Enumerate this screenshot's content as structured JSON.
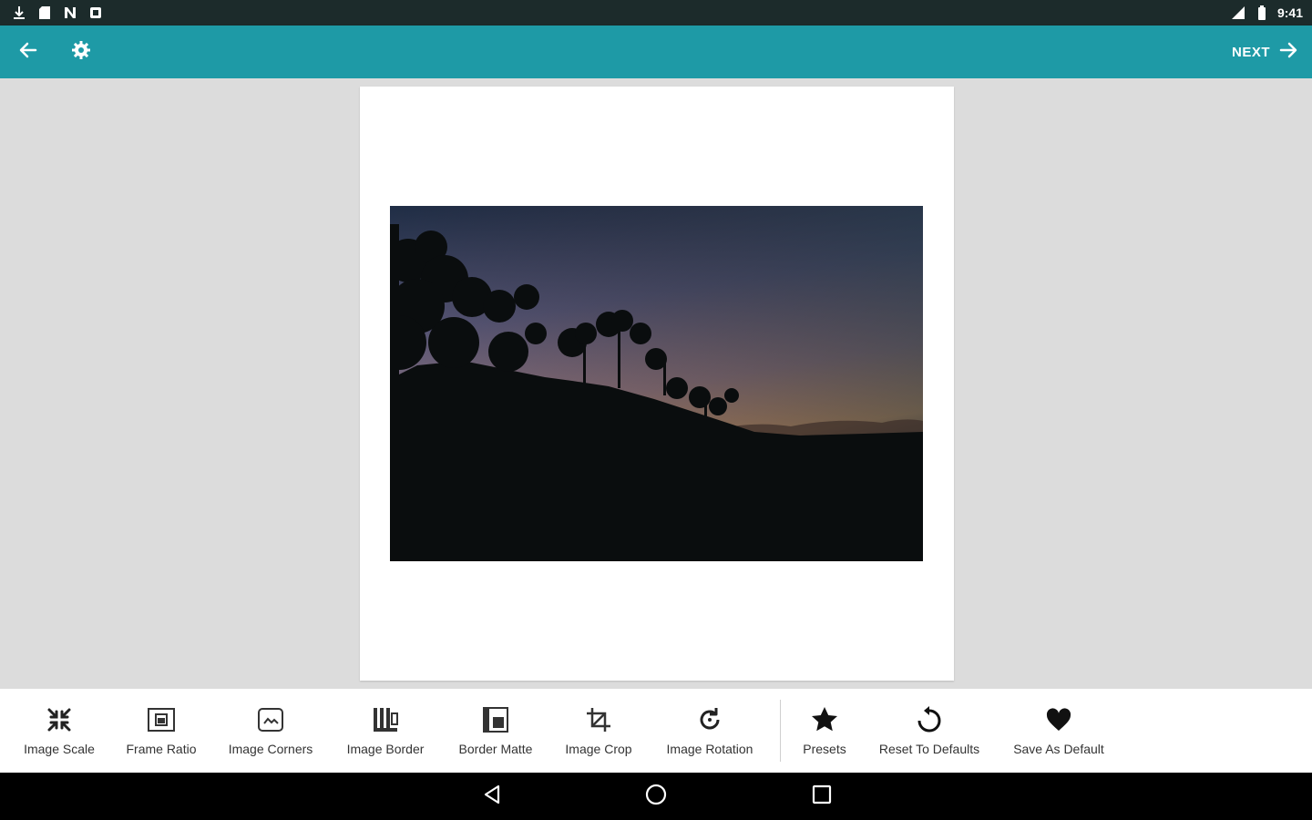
{
  "status_bar": {
    "time": "9:41",
    "left_icons": [
      "download-icon",
      "sd-card-icon",
      "n-icon",
      "notification-icon"
    ],
    "right_icons": [
      "signal-icon",
      "battery-icon"
    ]
  },
  "app_bar": {
    "back_icon": "arrow-left-icon",
    "settings_icon": "gear-icon",
    "next_label": "NEXT",
    "next_icon": "arrow-right-icon",
    "color": "#1e9aa6"
  },
  "toolbar": {
    "items": [
      {
        "label": "Image Scale",
        "icon": "scale-arrows-icon"
      },
      {
        "label": "Frame Ratio",
        "icon": "frame-ratio-icon"
      },
      {
        "label": "Image Corners",
        "icon": "image-corners-icon"
      },
      {
        "label": "Image Border",
        "icon": "image-border-icon"
      },
      {
        "label": "Border Matte",
        "icon": "border-matte-icon"
      },
      {
        "label": "Image Crop",
        "icon": "crop-icon"
      },
      {
        "label": "Image Rotation",
        "icon": "rotate-icon"
      },
      {
        "label": "Presets",
        "icon": "star-icon"
      },
      {
        "label": "Reset To Defaults",
        "icon": "reset-icon"
      },
      {
        "label": "Save As Default",
        "icon": "heart-icon"
      }
    ]
  },
  "nav_bar": {
    "icons": [
      "back-triangle-icon",
      "home-circle-icon",
      "recents-square-icon"
    ]
  }
}
